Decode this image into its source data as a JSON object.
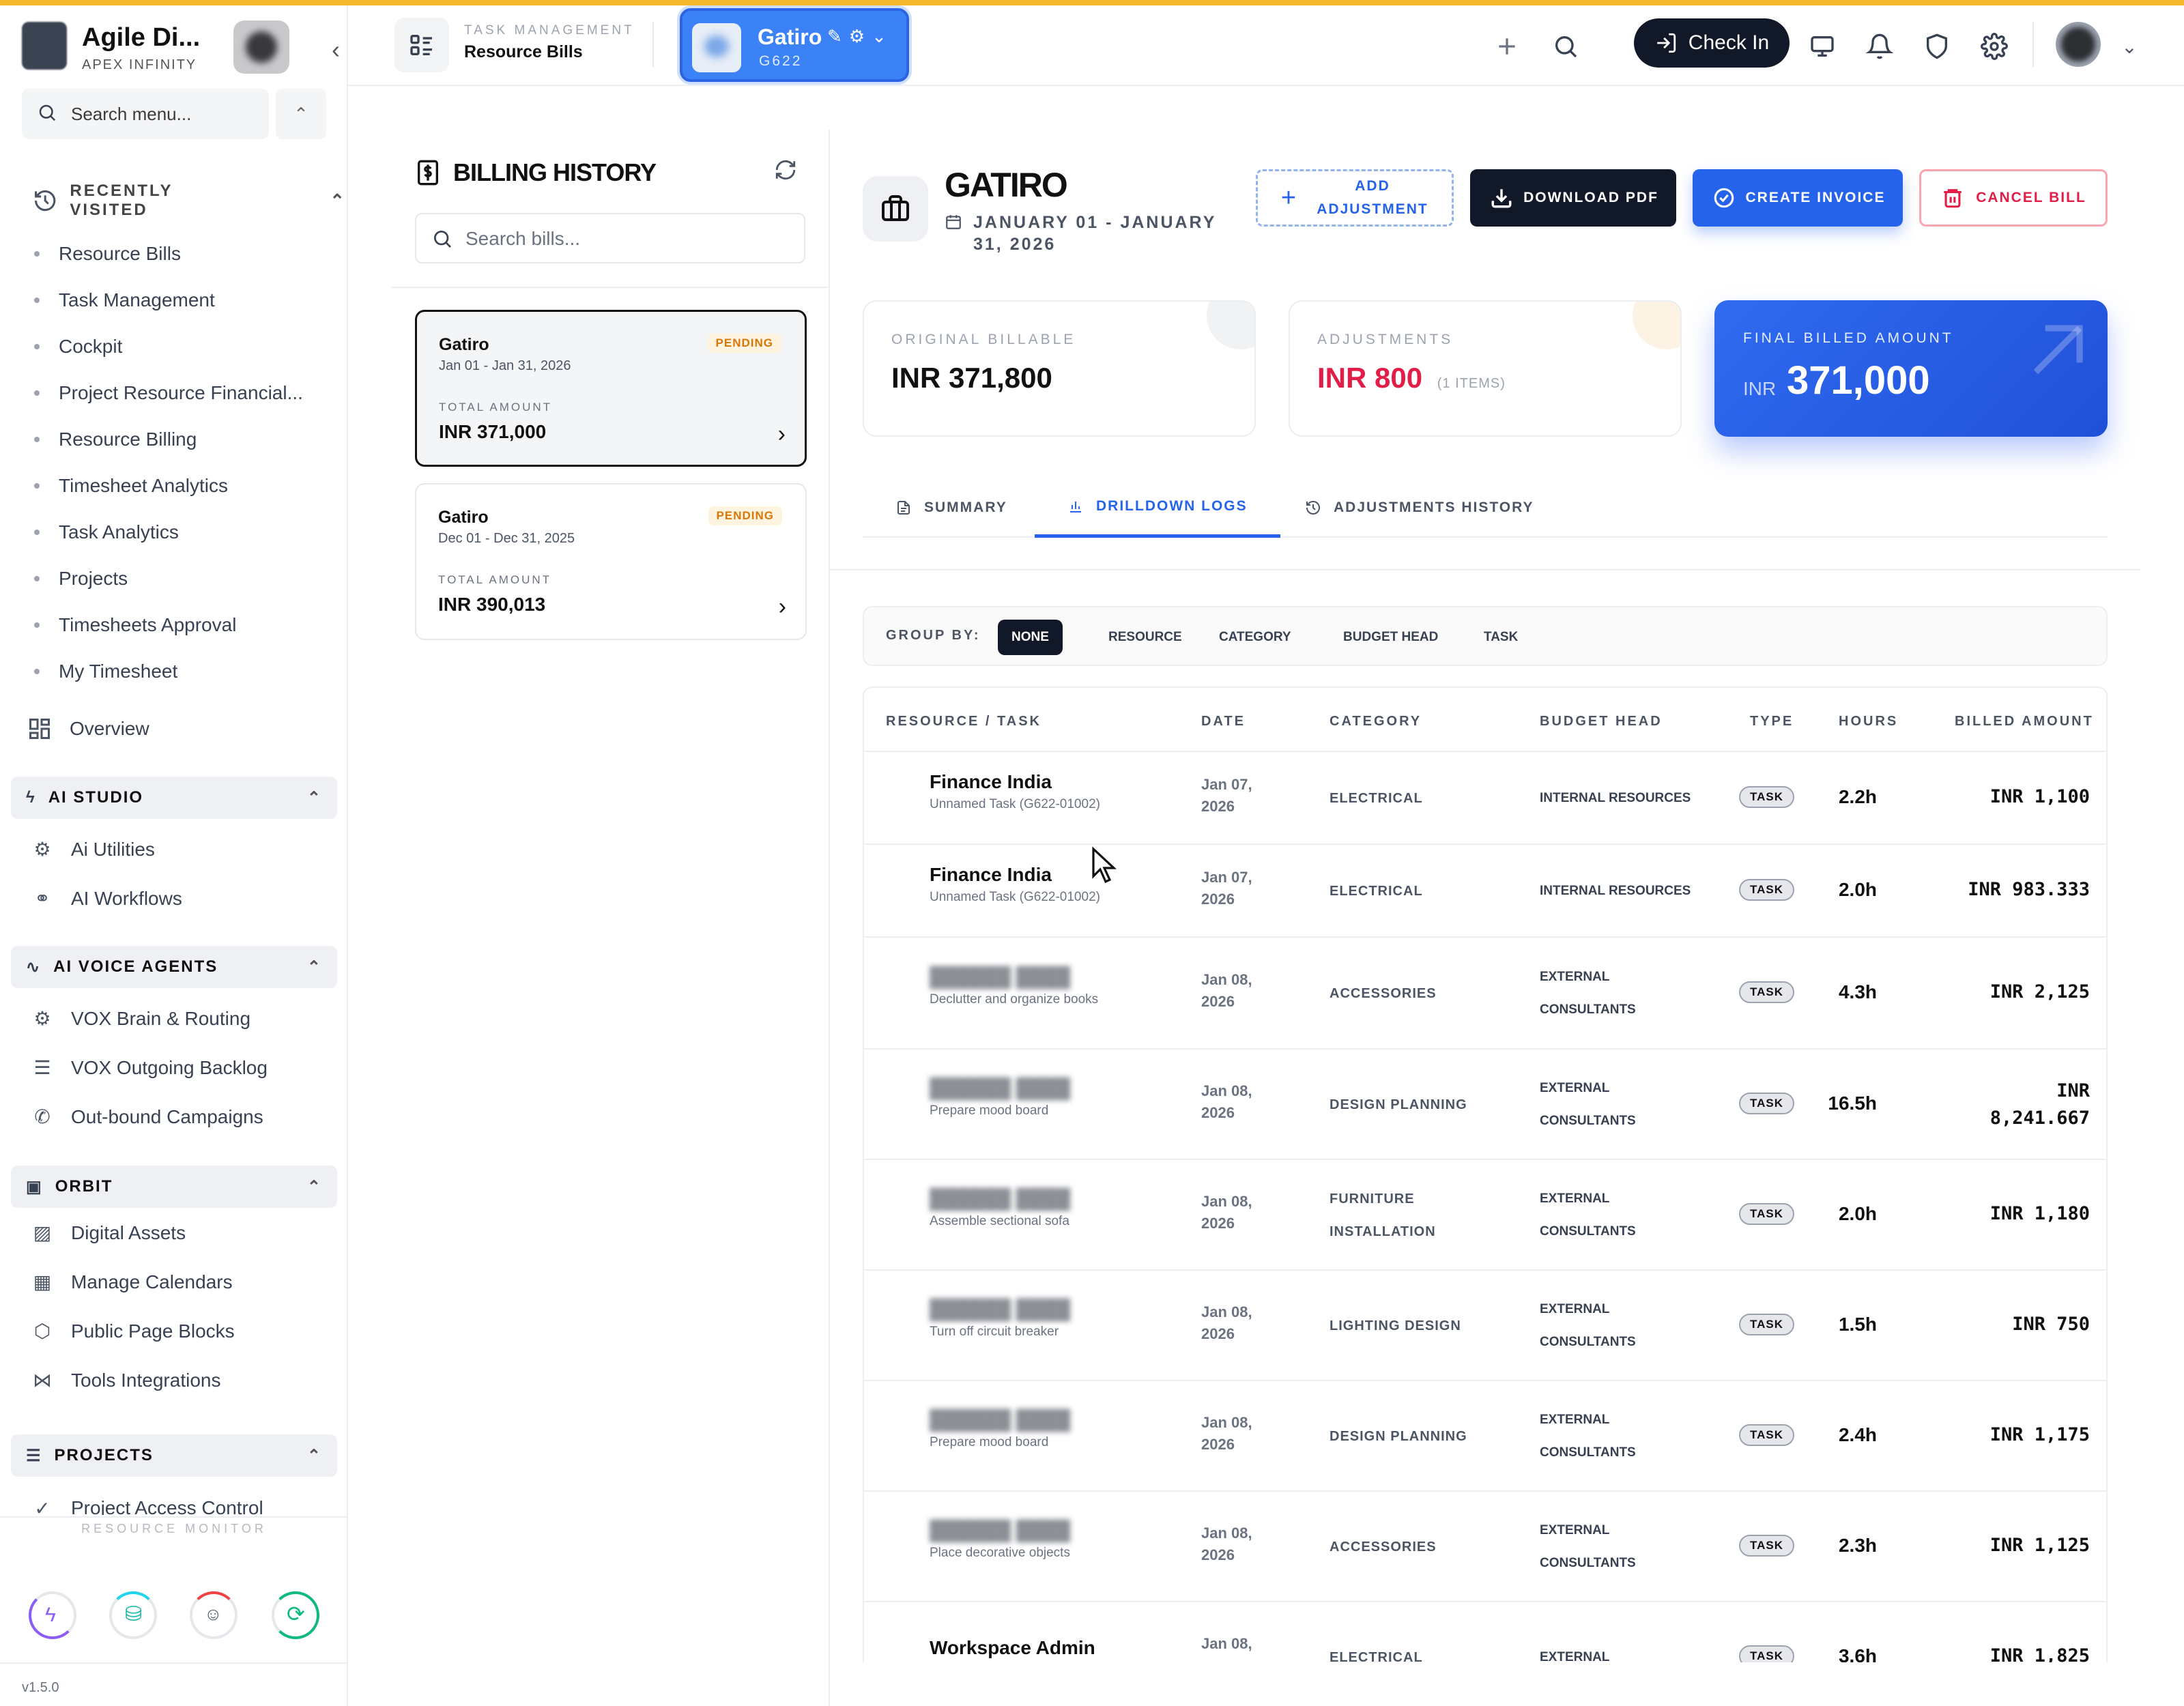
{
  "sidebar": {
    "brand_name": "Agile Di...",
    "brand_sub": "APEX INFINITY",
    "search_placeholder": "Search menu...",
    "recent_header": "RECENTLY VISITED",
    "recent_items": [
      "Resource Bills",
      "Task Management",
      "Cockpit",
      "Project Resource Financial...",
      "Resource Billing",
      "Timesheet Analytics",
      "Task Analytics",
      "Projects",
      "Timesheets Approval",
      "My Timesheet"
    ],
    "overview": "Overview",
    "groups": [
      {
        "label": "AI STUDIO",
        "items": [
          "Ai Utilities",
          "AI Workflows"
        ]
      },
      {
        "label": "AI VOICE AGENTS",
        "items": [
          "VOX Brain & Routing",
          "VOX Outgoing Backlog",
          "Out-bound Campaigns"
        ]
      },
      {
        "label": "ORBIT",
        "items": [
          "Digital Assets",
          "Manage Calendars",
          "Public Page Blocks",
          "Tools Integrations"
        ]
      },
      {
        "label": "PROJECTS",
        "items": [
          "Project Access Control"
        ]
      }
    ],
    "resource_monitor": "RESOURCE MONITOR",
    "version": "v1.5.0"
  },
  "header": {
    "module_label": "TASK MANAGEMENT",
    "module_title": "Resource Bills",
    "project_name": "Gatiro",
    "project_code": "G622",
    "check_in": "Check In"
  },
  "billing_history": {
    "title": "BILLING HISTORY",
    "search_placeholder": "Search bills...",
    "bills": [
      {
        "name": "Gatiro",
        "period": "Jan 01 - Jan 31, 2026",
        "status": "PENDING",
        "total_label": "TOTAL AMOUNT",
        "amount": "INR 371,000"
      },
      {
        "name": "Gatiro",
        "period": "Dec 01 - Dec 31, 2025",
        "status": "PENDING",
        "total_label": "TOTAL AMOUNT",
        "amount": "INR 390,013"
      }
    ]
  },
  "detail": {
    "client": "GATIRO",
    "period": "JANUARY 01 - JANUARY 31, 2026",
    "actions": {
      "add": "ADD ADJUSTMENT",
      "download": "DOWNLOAD PDF",
      "create": "CREATE INVOICE",
      "cancel": "CANCEL BILL"
    },
    "original_label": "ORIGINAL BILLABLE",
    "original_value": "INR 371,800",
    "adjust_label": "ADJUSTMENTS",
    "adjust_value": "INR 800",
    "adjust_count": "(1 ITEMS)",
    "final_label": "FINAL BILLED AMOUNT",
    "final_currency": "INR",
    "final_value": "371,000",
    "tabs": [
      "SUMMARY",
      "DRILLDOWN LOGS",
      "ADJUSTMENTS HISTORY"
    ],
    "active_tab": "DRILLDOWN LOGS",
    "group_by_label": "GROUP BY:",
    "group_by_options": [
      "NONE",
      "RESOURCE",
      "CATEGORY",
      "BUDGET HEAD",
      "TASK"
    ],
    "group_by_selected": "NONE"
  },
  "table": {
    "columns": [
      "RESOURCE / TASK",
      "DATE",
      "CATEGORY",
      "BUDGET HEAD",
      "TYPE",
      "HOURS",
      "BILLED AMOUNT"
    ],
    "rows": [
      {
        "resource": "Finance India",
        "blurred": false,
        "task": "Unnamed Task (G622-01002)",
        "date": "Jan 07, 2026",
        "category": "ELECTRICAL",
        "budget": "INTERNAL RESOURCES",
        "type": "TASK",
        "hours": "2.2h",
        "amount": "INR 1,100"
      },
      {
        "resource": "Finance India",
        "blurred": false,
        "task": "Unnamed Task (G622-01002)",
        "date": "Jan 07, 2026",
        "category": "ELECTRICAL",
        "budget": "INTERNAL RESOURCES",
        "type": "TASK",
        "hours": "2.0h",
        "amount": "INR 983.333"
      },
      {
        "resource": "",
        "blurred": true,
        "task": "Declutter and organize books",
        "date": "Jan 08, 2026",
        "category": "ACCESSORIES",
        "budget": "EXTERNAL CONSULTANTS",
        "type": "TASK",
        "hours": "4.3h",
        "amount": "INR 2,125"
      },
      {
        "resource": "",
        "blurred": true,
        "task": "Prepare mood board",
        "date": "Jan 08, 2026",
        "category": "DESIGN PLANNING",
        "budget": "EXTERNAL CONSULTANTS",
        "type": "TASK",
        "hours": "16.5h",
        "amount": "INR 8,241.667"
      },
      {
        "resource": "",
        "blurred": true,
        "task": "Assemble sectional sofa",
        "date": "Jan 08, 2026",
        "category": "FURNITURE INSTALLATION",
        "budget": "EXTERNAL CONSULTANTS",
        "type": "TASK",
        "hours": "2.0h",
        "amount": "INR 1,180"
      },
      {
        "resource": "",
        "blurred": true,
        "task": "Turn off circuit breaker",
        "date": "Jan 08, 2026",
        "category": "LIGHTING DESIGN",
        "budget": "EXTERNAL CONSULTANTS",
        "type": "TASK",
        "hours": "1.5h",
        "amount": "INR 750"
      },
      {
        "resource": "",
        "blurred": true,
        "task": "Prepare mood board",
        "date": "Jan 08, 2026",
        "category": "DESIGN PLANNING",
        "budget": "EXTERNAL CONSULTANTS",
        "type": "TASK",
        "hours": "2.4h",
        "amount": "INR 1,175"
      },
      {
        "resource": "",
        "blurred": true,
        "task": "Place decorative objects",
        "date": "Jan 08, 2026",
        "category": "ACCESSORIES",
        "budget": "EXTERNAL CONSULTANTS",
        "type": "TASK",
        "hours": "2.3h",
        "amount": "INR 1,125"
      },
      {
        "resource": "Workspace Admin",
        "blurred": false,
        "task": "",
        "date": "Jan 08,",
        "category": "ELECTRICAL",
        "budget": "EXTERNAL",
        "type": "TASK",
        "hours": "3.6h",
        "amount": "INR 1,825"
      }
    ]
  },
  "colors": {
    "accent": "#2563eb",
    "dark": "#111827",
    "danger": "#e11d48",
    "pending": "#d97706",
    "top_stripe": "#f5b82e"
  }
}
